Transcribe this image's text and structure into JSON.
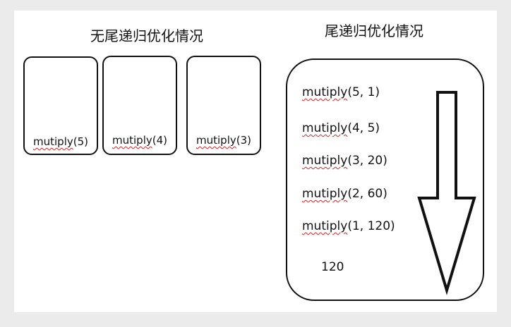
{
  "headings": {
    "no_tco": "无尾递归优化情况",
    "tco": "尾递归优化情况"
  },
  "stack_frames": [
    {
      "fn": "mutiply",
      "args": "(5)"
    },
    {
      "fn": "mutiply",
      "args": "(4)"
    },
    {
      "fn": "mutiply",
      "args": "(3)"
    }
  ],
  "tail_calls": [
    {
      "fn": "mutiply",
      "args": "(5, 1)"
    },
    {
      "fn": "mutiply",
      "args": "(4, 5)"
    },
    {
      "fn": "mutiply",
      "args": "(3, 20)"
    },
    {
      "fn": "mutiply",
      "args": "(2, 60)"
    },
    {
      "fn": "mutiply",
      "args": "(1, 120)"
    }
  ],
  "result": "120",
  "arrow_icon": "down-arrow-icon"
}
